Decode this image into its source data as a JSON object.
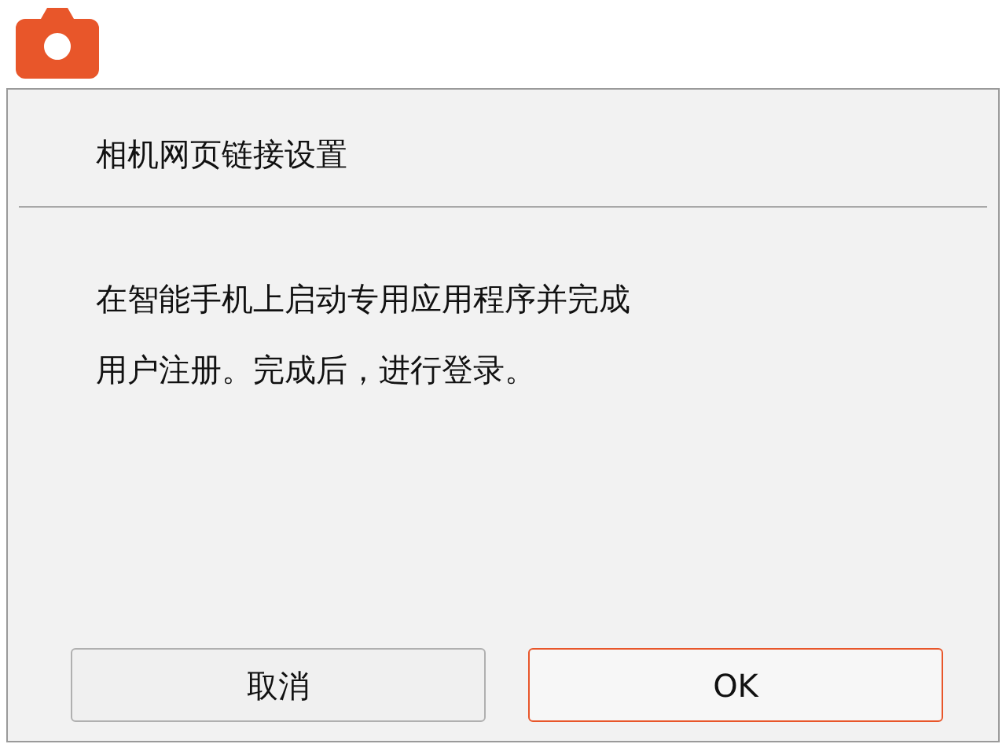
{
  "dialog": {
    "title": "相机网页链接设置",
    "message_lines": [
      "在智能手机上启动专用应用程序并完成",
      "用户注册。完成后，进行登录。"
    ]
  },
  "buttons": [
    {
      "label": "取消",
      "selected": false
    },
    {
      "label": "OK",
      "selected": true
    }
  ]
}
